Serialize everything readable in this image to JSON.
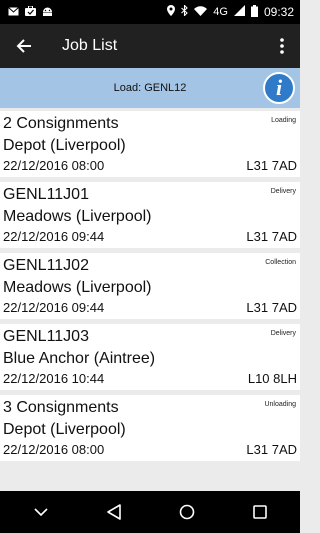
{
  "status_bar": {
    "network": "4G",
    "time": "09:32",
    "left_icons": [
      "mail-icon",
      "briefcase-icon",
      "android-icon"
    ],
    "right_icons": [
      "location-icon",
      "bluetooth-icon",
      "wifi-icon",
      "signal-icon",
      "battery-icon"
    ]
  },
  "app_bar": {
    "title": "Job List",
    "back_icon": "arrow-left-icon",
    "menu_icon": "more-vert-icon"
  },
  "banner": {
    "text": "Load: GENL12",
    "info_label": "i",
    "color": "#a3c4e5"
  },
  "jobs": [
    {
      "name": "2 Consignments",
      "type": "Loading",
      "place": "Depot (Liverpool)",
      "datetime": "22/12/2016 08:00",
      "postcode": "L31 7AD"
    },
    {
      "name": "GENL11J01",
      "type": "Delivery",
      "place": "Meadows (Liverpool)",
      "datetime": "22/12/2016 09:44",
      "postcode": "L31 7AD"
    },
    {
      "name": "GENL11J02",
      "type": "Collection",
      "place": "Meadows (Liverpool)",
      "datetime": "22/12/2016 09:44",
      "postcode": "L31 7AD"
    },
    {
      "name": "GENL11J03",
      "type": "Delivery",
      "place": "Blue Anchor (Aintree)",
      "datetime": "22/12/2016 10:44",
      "postcode": "L10 8LH"
    },
    {
      "name": "3 Consignments",
      "type": "Unloading",
      "place": "Depot (Liverpool)",
      "datetime": "22/12/2016 08:00",
      "postcode": "L31 7AD"
    }
  ],
  "nav_bar": {
    "buttons": [
      "chevron-down-icon",
      "back-triangle-icon",
      "home-circle-icon",
      "recents-square-icon"
    ]
  }
}
